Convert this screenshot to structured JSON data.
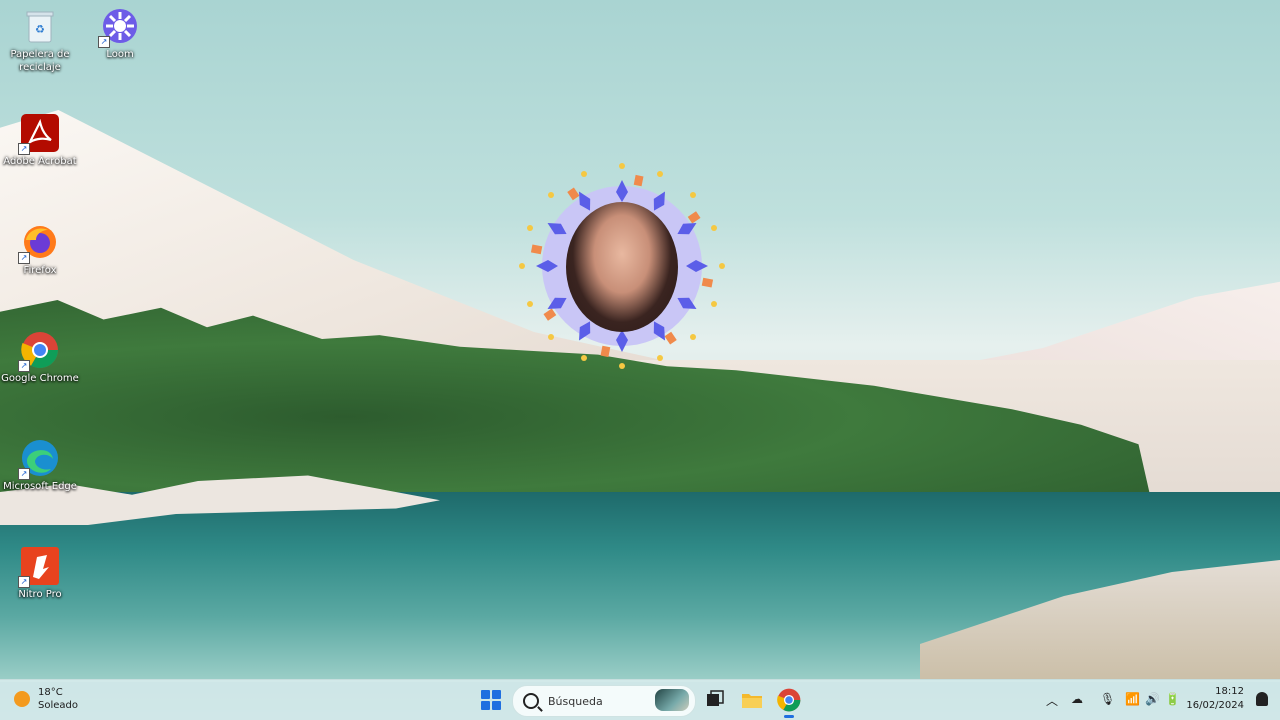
{
  "desktop": {
    "icons": [
      {
        "id": "recycle",
        "label": "Papelera de reciclaje"
      },
      {
        "id": "loom",
        "label": "Loom"
      },
      {
        "id": "acrobat",
        "label": "Adobe Acrobat"
      },
      {
        "id": "firefox",
        "label": "Firefox"
      },
      {
        "id": "chrome",
        "label": "Google Chrome"
      },
      {
        "id": "edge",
        "label": "Microsoft Edge"
      },
      {
        "id": "nitro",
        "label": "Nitro Pro"
      }
    ]
  },
  "taskbar": {
    "weather": {
      "temp": "18°C",
      "condition": "Soleado",
      "icon": "sun-icon"
    },
    "search_placeholder": "Búsqueda",
    "apps": [
      "windows-start",
      "search",
      "task-view",
      "file-explorer",
      "google-chrome"
    ],
    "tray_icons": [
      "chevron-up-icon",
      "onedrive-icon",
      "microphone-icon",
      "wifi-icon",
      "volume-icon",
      "battery-icon",
      "notification-icon"
    ],
    "clock": {
      "time": "18:12",
      "date": "16/02/2024"
    }
  },
  "colors": {
    "start_blue": "#1f6fe0",
    "taskbar_bg": "#d6ebec",
    "weather_sun": "#f39a1e"
  }
}
